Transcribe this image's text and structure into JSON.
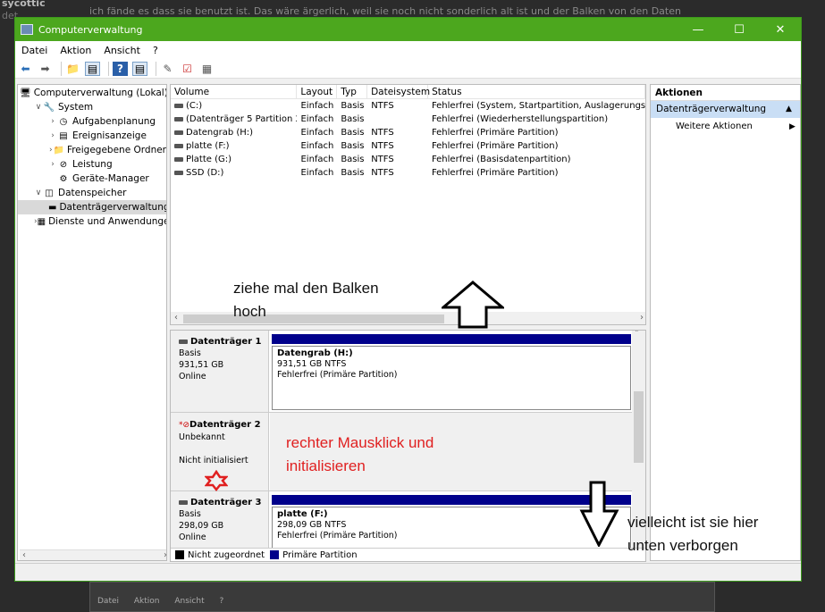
{
  "window": {
    "title": "Computerverwaltung"
  },
  "menu": [
    "Datei",
    "Aktion",
    "Ansicht",
    "?"
  ],
  "tree": [
    {
      "label": "Computerverwaltung (Lokal)",
      "icon": "computer-icon",
      "level": 0,
      "expand": ""
    },
    {
      "label": "System",
      "icon": "tools-icon",
      "level": 1,
      "expand": "v"
    },
    {
      "label": "Aufgabenplanung",
      "icon": "clock-icon",
      "level": 2,
      "expand": ">"
    },
    {
      "label": "Ereignisanzeige",
      "icon": "event-icon",
      "level": 2,
      "expand": ">"
    },
    {
      "label": "Freigegebene Ordner",
      "icon": "folder-icon",
      "level": 2,
      "expand": ">"
    },
    {
      "label": "Leistung",
      "icon": "performance-icon",
      "level": 2,
      "expand": ">"
    },
    {
      "label": "Geräte-Manager",
      "icon": "device-icon",
      "level": 2,
      "expand": ""
    },
    {
      "label": "Datenspeicher",
      "icon": "storage-icon",
      "level": 1,
      "expand": "v"
    },
    {
      "label": "Datenträgerverwaltung",
      "icon": "disk-icon",
      "level": 2,
      "expand": "",
      "selected": true
    },
    {
      "label": "Dienste und Anwendungen",
      "icon": "services-icon",
      "level": 1,
      "expand": ">"
    }
  ],
  "volumes": {
    "headers": [
      "Volume",
      "Layout",
      "Typ",
      "Dateisystem",
      "Status"
    ],
    "rows": [
      [
        "(C:)",
        "Einfach",
        "Basis",
        "NTFS",
        "Fehlerfrei (System, Startpartition, Auslagerungsdat"
      ],
      [
        "(Datenträger 5 Partition 2)",
        "Einfach",
        "Basis",
        "",
        "Fehlerfrei (Wiederherstellungspartition)"
      ],
      [
        "Datengrab (H:)",
        "Einfach",
        "Basis",
        "NTFS",
        "Fehlerfrei (Primäre Partition)"
      ],
      [
        "platte (F:)",
        "Einfach",
        "Basis",
        "NTFS",
        "Fehlerfrei (Primäre Partition)"
      ],
      [
        "Platte (G:)",
        "Einfach",
        "Basis",
        "NTFS",
        "Fehlerfrei (Basisdatenpartition)"
      ],
      [
        "SSD (D:)",
        "Einfach",
        "Basis",
        "NTFS",
        "Fehlerfrei (Primäre Partition)"
      ]
    ]
  },
  "disks": [
    {
      "name": "Datenträger 1",
      "type": "Basis",
      "size": "931,51 GB",
      "state": "Online",
      "partition": {
        "name": "Datengrab  (H:)",
        "size": "931,51 GB NTFS",
        "status": "Fehlerfrei (Primäre Partition)"
      }
    },
    {
      "name": "Datenträger 2",
      "type": "Unbekannt",
      "size": "",
      "state": "Nicht initialisiert"
    },
    {
      "name": "Datenträger 3",
      "type": "Basis",
      "size": "298,09 GB",
      "state": "Online",
      "partition": {
        "name": "platte  (F:)",
        "size": "298,09 GB NTFS",
        "status": "Fehlerfrei (Primäre Partition)"
      }
    }
  ],
  "legend": [
    {
      "label": "Nicht zugeordnet",
      "color": "#000000"
    },
    {
      "label": "Primäre Partition",
      "color": "#00008b"
    }
  ],
  "actions": {
    "header": "Aktionen",
    "section": "Datenträgerverwaltung",
    "item": "Weitere Aktionen"
  },
  "annotations": {
    "drag_line1": "ziehe mal den Balken",
    "drag_line2": "hoch",
    "rightclick_line1": "rechter Mausklick und",
    "rightclick_line2": "initialisieren",
    "hidden_line1": "vielleicht ist sie hier",
    "hidden_line2": "unten verborgen"
  },
  "background": {
    "user": "sycottic",
    "line2": "det",
    "text": "ich fände es dass sie benutzt ist. Das wäre ärgerlich, weil sie noch nicht sonderlich alt ist und der Balken von den Daten"
  },
  "colors": {
    "titlebar": "#4ca71e",
    "partition_bar": "#00008b",
    "annotation_red": "#e02020"
  }
}
